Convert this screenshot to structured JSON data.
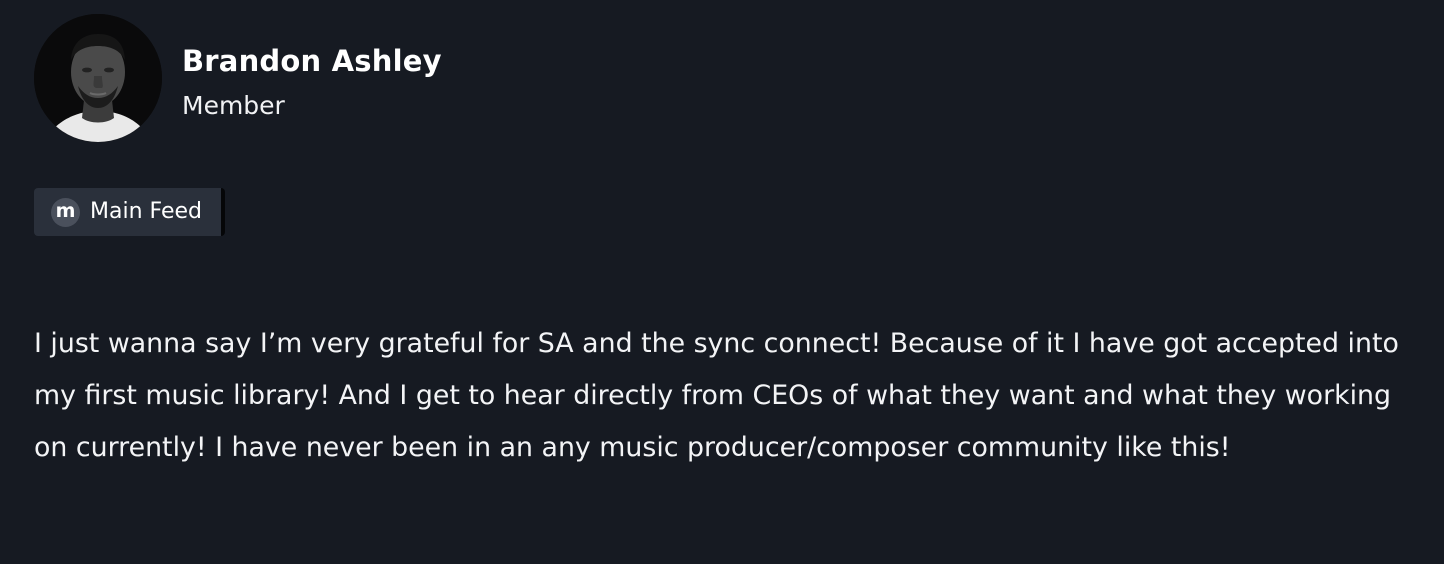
{
  "author": {
    "name": "Brandon Ashley",
    "role": "Member"
  },
  "feed_chip": {
    "icon_letter": "m",
    "icon_name": "community-logo-icon",
    "label": "Main Feed"
  },
  "post": {
    "text": "I just wanna say I’m very grateful for SA and the sync connect! Because of it I have got accepted into my first music library! And I get to hear directly from CEOs of what they want and what they working on currently! I have never been in an any music producer/composer community like this!"
  },
  "colors": {
    "background": "#161a22",
    "chip_background": "#2a303b",
    "text": "#ffffff"
  }
}
